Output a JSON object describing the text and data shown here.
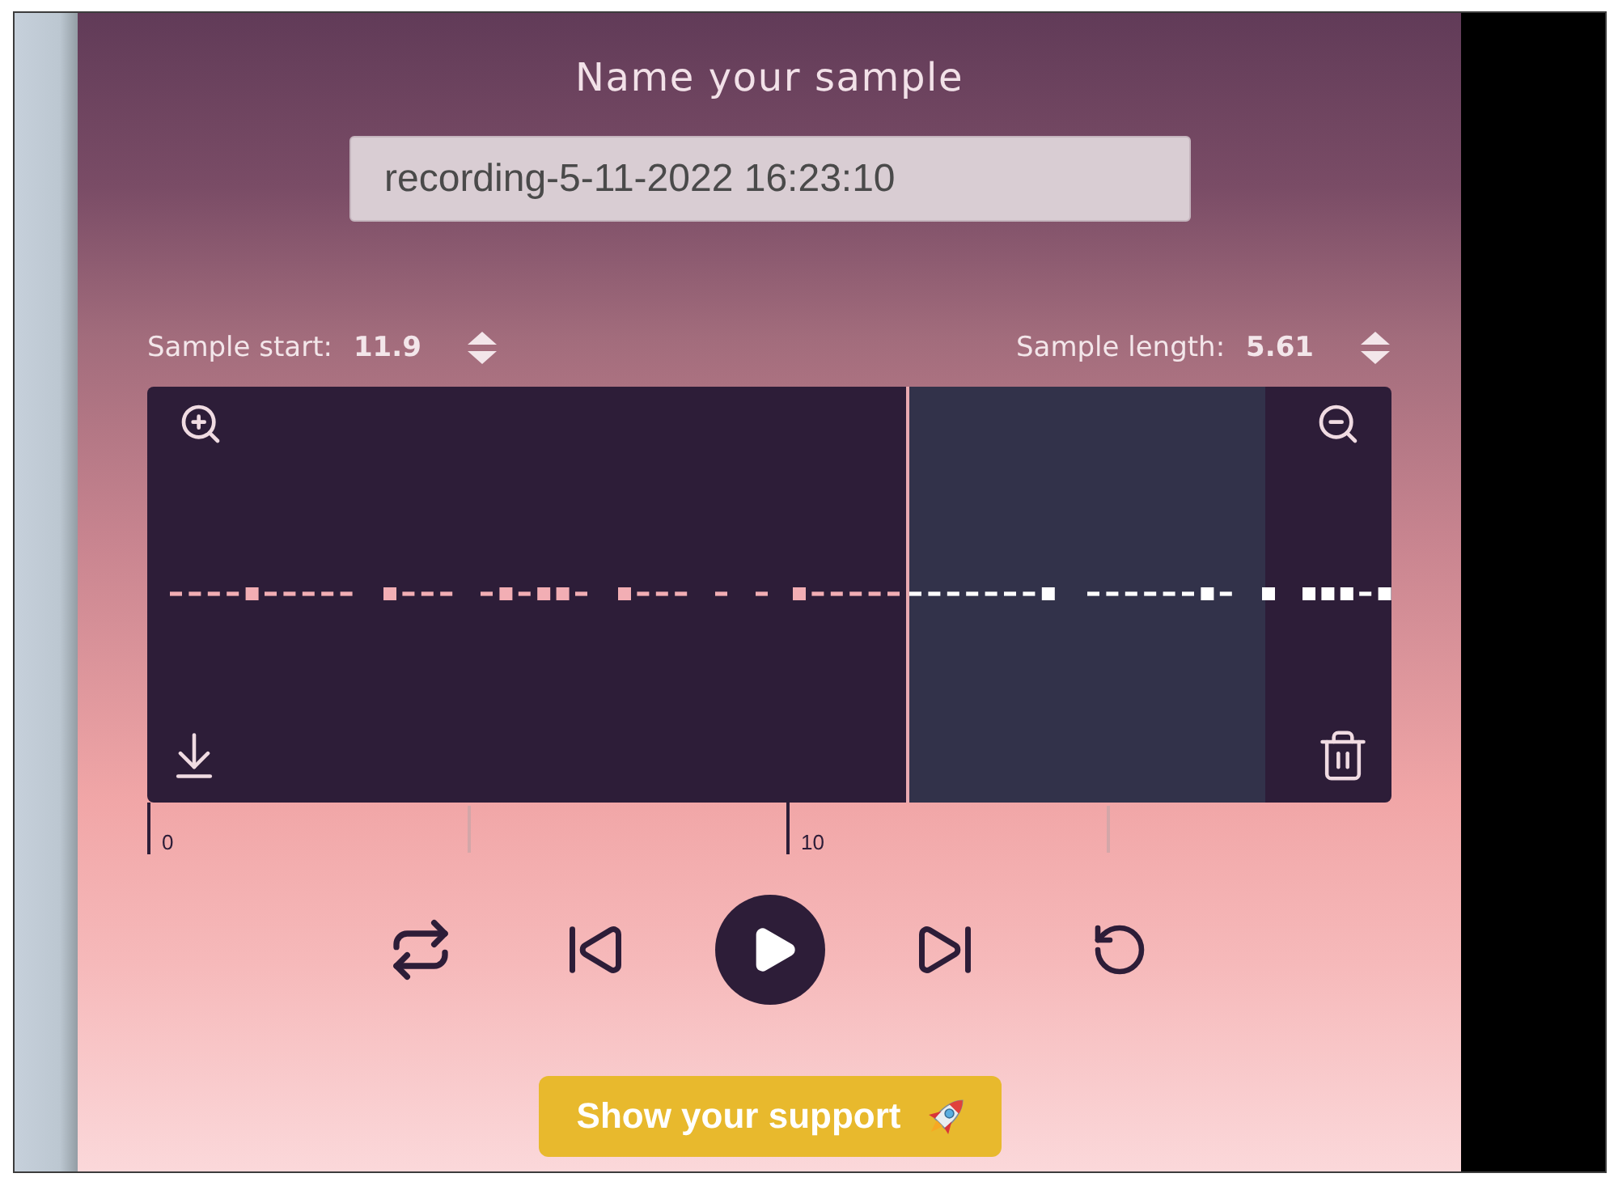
{
  "title": "Name your sample",
  "name_field": {
    "value": "recording-5-11-2022 16:23:10"
  },
  "sample_fields": [
    {
      "label": "Sample start:",
      "value": "11.9"
    },
    {
      "label": "Sample length:",
      "value": "5.61"
    }
  ],
  "ruler": {
    "labels": [
      "0",
      "10"
    ]
  },
  "player": {
    "playing": false
  },
  "support_button": {
    "label": "Show your support"
  }
}
